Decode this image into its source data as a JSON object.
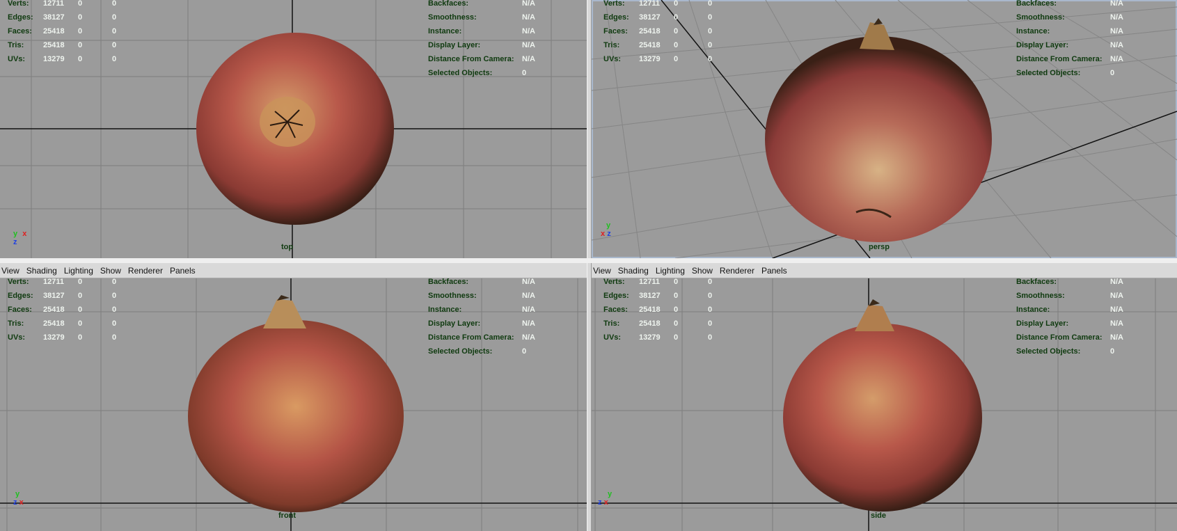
{
  "menu": [
    "View",
    "Shading",
    "Lighting",
    "Show",
    "Renderer",
    "Panels"
  ],
  "stats_left": [
    {
      "label": "Verts:",
      "v1": "12711",
      "v2": "0",
      "v3": "0"
    },
    {
      "label": "Edges:",
      "v1": "38127",
      "v2": "0",
      "v3": "0"
    },
    {
      "label": "Faces:",
      "v1": "25418",
      "v2": "0",
      "v3": "0"
    },
    {
      "label": "Tris:",
      "v1": "25418",
      "v2": "0",
      "v3": "0"
    },
    {
      "label": "UVs:",
      "v1": "13279",
      "v2": "0",
      "v3": "0"
    }
  ],
  "stats_right": [
    {
      "label": "Backfaces:",
      "value": "N/A"
    },
    {
      "label": "Smoothness:",
      "value": "N/A"
    },
    {
      "label": "Instance:",
      "value": "N/A"
    },
    {
      "label": "Display Layer:",
      "value": "N/A"
    },
    {
      "label": "Distance From Camera:",
      "value": "N/A"
    },
    {
      "label": "Selected Objects:",
      "value": "0"
    }
  ],
  "viewports": {
    "top": {
      "camera": "top"
    },
    "persp": {
      "camera": "persp"
    },
    "front": {
      "camera": "front"
    },
    "side": {
      "camera": "side"
    }
  },
  "axes": {
    "x": "x",
    "y": "y",
    "z": "z"
  },
  "colors": {
    "viewport_bg": "#9b9b9b",
    "grid": "#7e7e7e",
    "axis_line": "#111111",
    "hud_label": "#0f3a0f",
    "hud_value": "#eef3ee",
    "axis_x": "#e02020",
    "axis_y": "#20c020",
    "axis_z": "#2040e0"
  }
}
